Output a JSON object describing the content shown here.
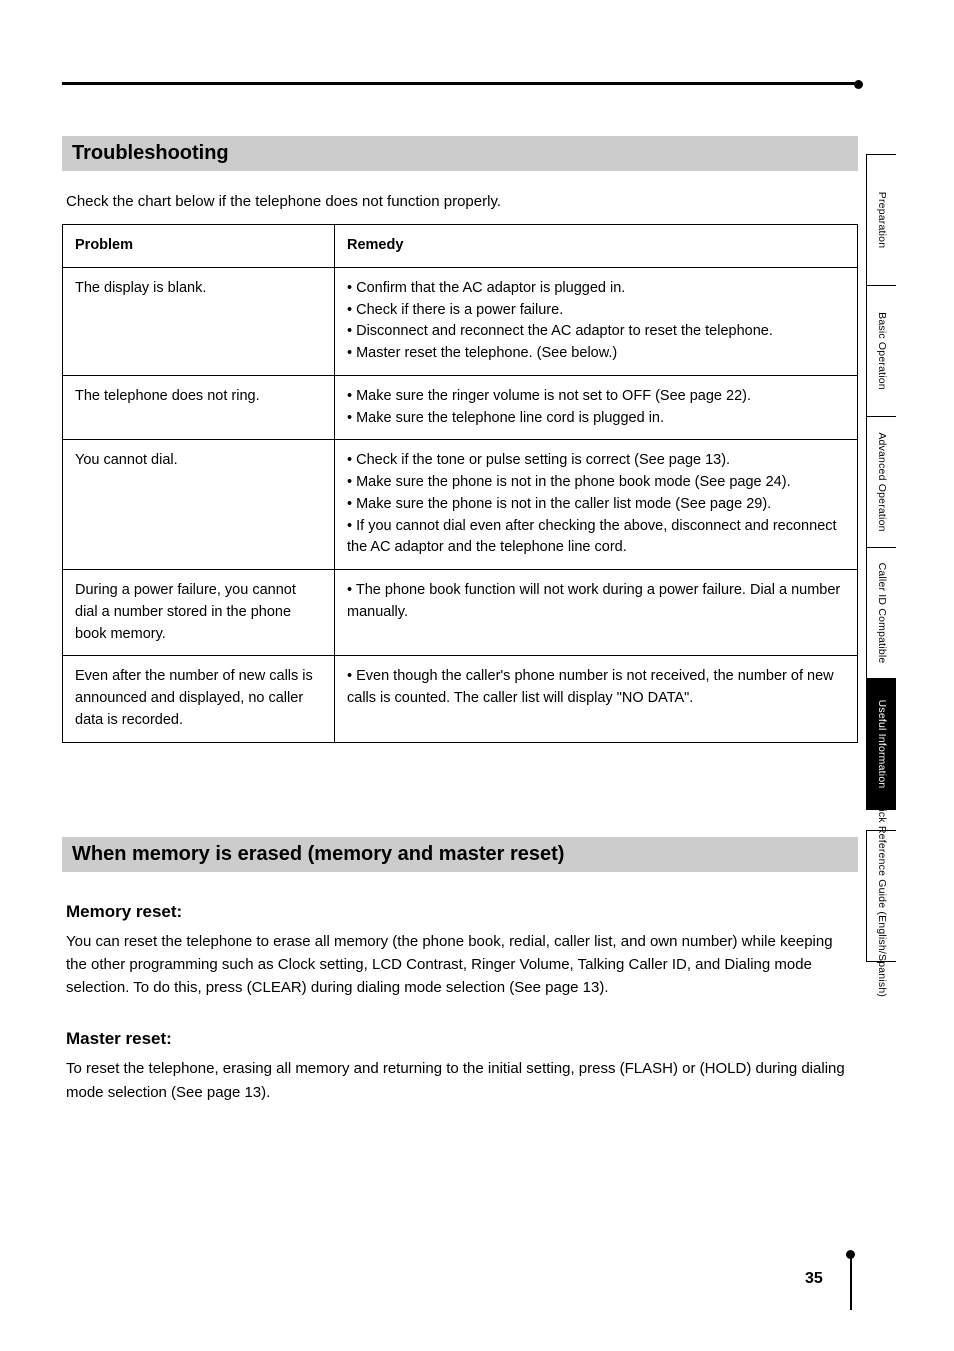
{
  "section1_title": "Troubleshooting",
  "lead": "Check the chart below if the telephone does not function properly.",
  "table": {
    "headers": [
      "Problem",
      "Remedy"
    ],
    "rows": [
      {
        "problem": "The display is blank.",
        "remedies": [
          "Confirm that the AC adaptor is plugged in.",
          "Check if there is a power failure.",
          "Disconnect and reconnect the AC adaptor to reset the telephone.",
          "Master reset the telephone. (See below.)"
        ]
      },
      {
        "problem": "The telephone does not ring.",
        "remedies": [
          "Make sure the ringer volume is not set to OFF (See page 22).",
          "Make sure the telephone line cord is plugged in."
        ]
      },
      {
        "problem": "You cannot dial.",
        "remedies": [
          "Check if the tone or pulse setting is correct (See page 13).",
          "Make sure the phone is not in the phone book mode (See page 24).",
          "Make sure the phone is not in the caller list mode (See page 29).",
          "If you cannot dial even after checking the above, disconnect and reconnect the AC adaptor and the telephone line cord."
        ]
      },
      {
        "problem": "During a power failure, you cannot dial a number stored in the phone book memory.",
        "remedies": [
          "The phone book function will not work during a power failure. Dial a number manually."
        ]
      },
      {
        "problem": "Even after the number of new calls is announced and displayed, no caller data is recorded.",
        "remedies": [
          "Even though the caller's phone number is not received, the number of new calls is counted. The caller list will display \"NO DATA\"."
        ]
      }
    ]
  },
  "section2_title": "When memory is erased (memory and master reset)",
  "reset_types": [
    {
      "title": "Memory reset:",
      "text": "You can reset the telephone to erase all memory (the phone book, redial, caller list, and own number) while keeping the other programming such as Clock setting, LCD Contrast, Ringer Volume, Talking Caller ID, and Dialing mode selection. To do this, press (CLEAR) during dialing mode selection (See page 13)."
    },
    {
      "title": "Master reset:",
      "text": "To reset the telephone, erasing all memory and returning to the initial setting, press (FLASH) or (HOLD) during dialing mode selection (See page 13)."
    }
  ],
  "tabs": [
    {
      "label": "Preparation",
      "active": false
    },
    {
      "label": "Basic Operation",
      "active": false
    },
    {
      "label": "Advanced Operation",
      "active": false
    },
    {
      "label": "Caller ID Compatible",
      "active": false
    },
    {
      "label": "Useful Information",
      "active": true
    },
    {
      "label": "Quick Reference Guide (English/Spanish)",
      "active": false,
      "guide": true
    }
  ],
  "page_number": "35"
}
